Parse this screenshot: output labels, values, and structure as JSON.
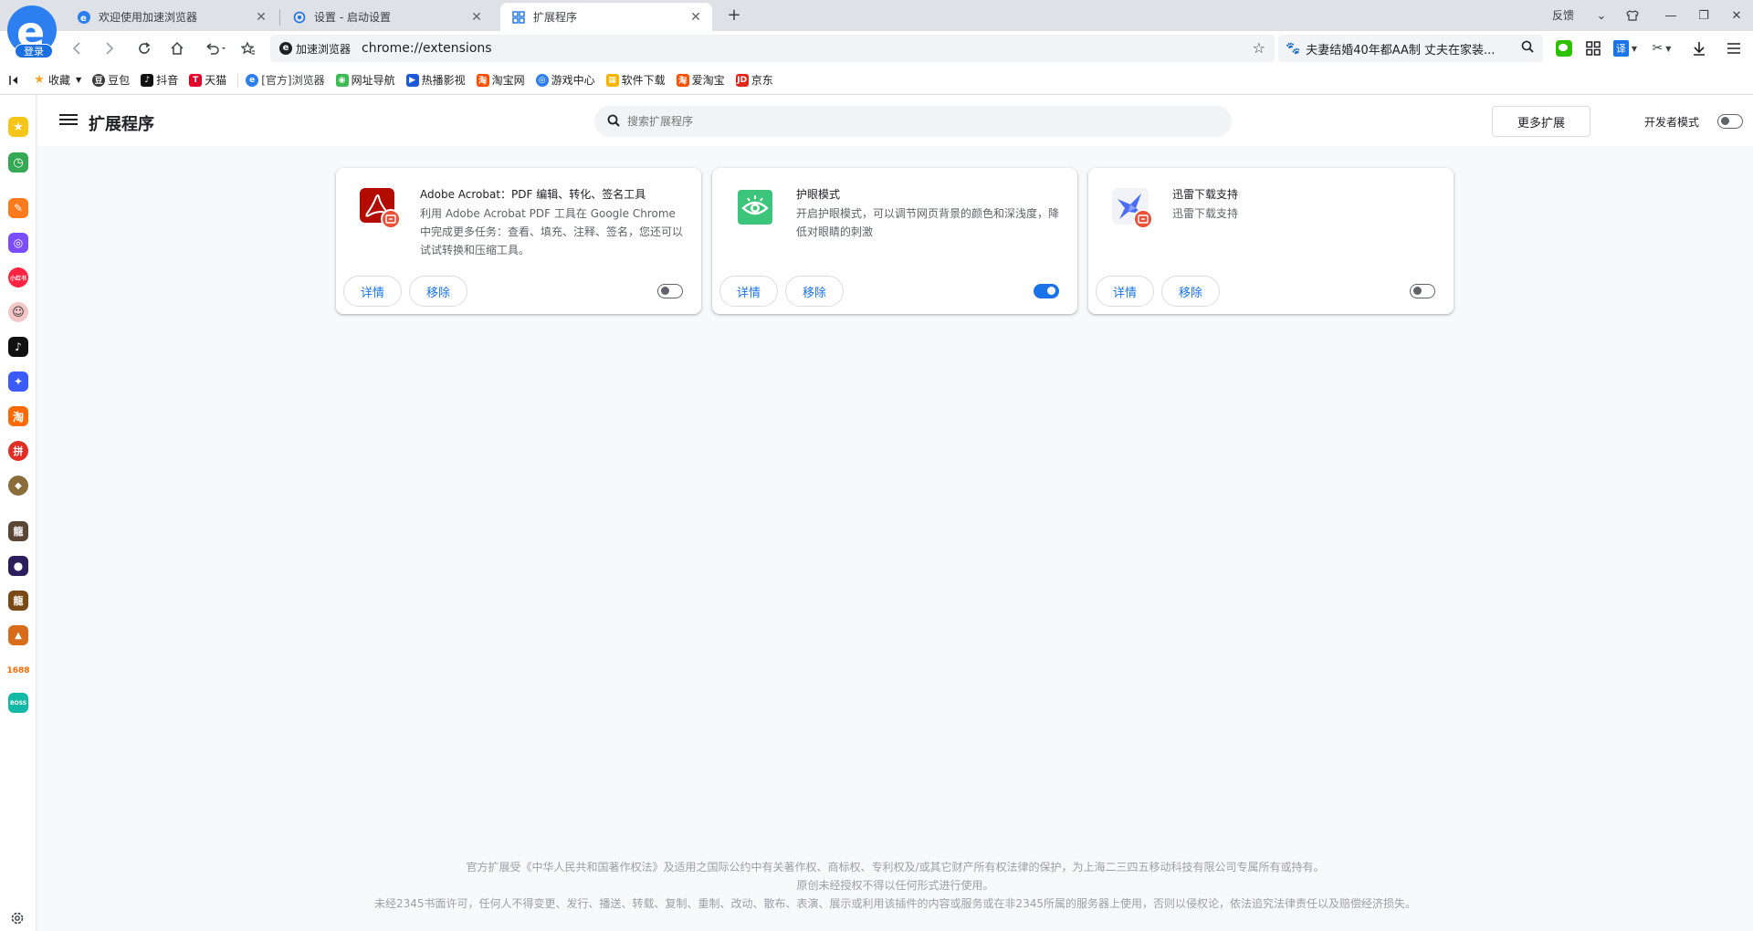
{
  "browser": {
    "login_label": "登录",
    "tabs": [
      {
        "label": "欢迎使用加速浏览器",
        "icon": "browser-logo-icon"
      },
      {
        "label": "设置 - 启动设置",
        "icon": "settings-icon"
      },
      {
        "label": "扩展程序",
        "icon": "extensions-grid-icon",
        "active": true
      }
    ],
    "feedback_label": "反馈"
  },
  "toolbar": {
    "site_name": "加速浏览器",
    "url": "chrome://extensions",
    "search_text": "夫妻结婚40年都AA制 丈夫在家装..."
  },
  "bookmarks": [
    {
      "label": "收藏",
      "color": "#f5a623"
    },
    {
      "label": "豆包",
      "color": "#3a3a3a"
    },
    {
      "label": "抖音",
      "color": "#111111"
    },
    {
      "label": "天猫",
      "color": "#e4002b"
    },
    {
      "label": "[官方]浏览器",
      "color": "#2d7ff0"
    },
    {
      "label": "网址导航",
      "color": "#3cba54"
    },
    {
      "label": "热播影视",
      "color": "#1e5ad7"
    },
    {
      "label": "淘宝网",
      "color": "#ff5000"
    },
    {
      "label": "游戏中心",
      "color": "#2d7ff0"
    },
    {
      "label": "软件下载",
      "color": "#f4b400"
    },
    {
      "label": "爱淘宝",
      "color": "#ff5000"
    },
    {
      "label": "京东",
      "color": "#e1251b"
    }
  ],
  "sidebar_icons": [
    {
      "name": "favorites",
      "color": "#f5c518",
      "glyph": "★"
    },
    {
      "name": "history",
      "color": "#34a853",
      "glyph": "◷"
    },
    {
      "name": "tools",
      "color": "#ff7a1a",
      "glyph": "✎"
    },
    {
      "name": "games",
      "color": "#7b4dff",
      "glyph": "◎"
    },
    {
      "name": "xiaohongshu",
      "color": "#ff2442",
      "glyph": "小红书"
    },
    {
      "name": "avatar-girl",
      "color": "#f3c6c6",
      "glyph": "☺"
    },
    {
      "name": "douyin",
      "color": "#111111",
      "glyph": "♪"
    },
    {
      "name": "app-blue",
      "color": "#3b5bfd",
      "glyph": "✦"
    },
    {
      "name": "taobao",
      "color": "#ff6a00",
      "glyph": "淘"
    },
    {
      "name": "pdd",
      "color": "#e02e24",
      "glyph": "拼"
    },
    {
      "name": "game-1",
      "color": "#8a6d3b",
      "glyph": "◆"
    },
    {
      "name": "game-2",
      "color": "#5b4636",
      "glyph": "龍"
    },
    {
      "name": "game-3",
      "color": "#2a1f5c",
      "glyph": "●"
    },
    {
      "name": "game-4",
      "color": "#7a4a16",
      "glyph": "龍"
    },
    {
      "name": "game-5",
      "color": "#d86c1a",
      "glyph": "▲"
    },
    {
      "name": "1688",
      "color": "#ffffff",
      "glyph": "1688",
      "text_color": "#ff6a00"
    },
    {
      "name": "boss-zhipin",
      "color": "#14b8a6",
      "glyph": "BOSS"
    }
  ],
  "extensions_page": {
    "title": "扩展程序",
    "search_placeholder": "搜索扩展程序",
    "more_extensions": "更多扩展",
    "developer_mode": "开发者模式",
    "details_label": "详情",
    "remove_label": "移除",
    "cards": [
      {
        "name": "Adobe Acrobat：PDF 编辑、转化、签名工具",
        "description": "利用 Adobe Acrobat PDF 工具在 Google Chrome 中完成更多任务：查看、填充、注释、签名，您还可以试试转换和压缩工具。",
        "enabled": false,
        "icon": "adobe-acrobat-icon"
      },
      {
        "name": "护眼模式",
        "description": "开启护眼模式，可以调节网页背景的颜色和深浅度，降低对眼睛的刺激",
        "enabled": true,
        "icon": "eye-care-icon"
      },
      {
        "name": "迅雷下载支持",
        "description": "迅雷下载支持",
        "enabled": false,
        "icon": "thunder-download-icon"
      }
    ],
    "footer_lines": [
      "官方扩展受《中华人民共和国著作权法》及适用之国际公约中有关著作权、商标权、专利权及/或其它财产所有权法律的保护，为上海二三四五移动科技有限公司专属所有或持有。",
      "原创未经授权不得以任何形式进行使用。",
      "未经2345书面许可，任何人不得变更、发行、播送、转载、复制、重制、改动、散布、表演、展示或利用该插件的内容或服务或在非2345所属的服务器上使用，否则以侵权论，依法追究法律责任以及赔偿经济损失。"
    ]
  },
  "colors": {
    "accent": "#1a73e8",
    "adobe_red": "#b30b00",
    "eye_green": "#3cc47a"
  }
}
